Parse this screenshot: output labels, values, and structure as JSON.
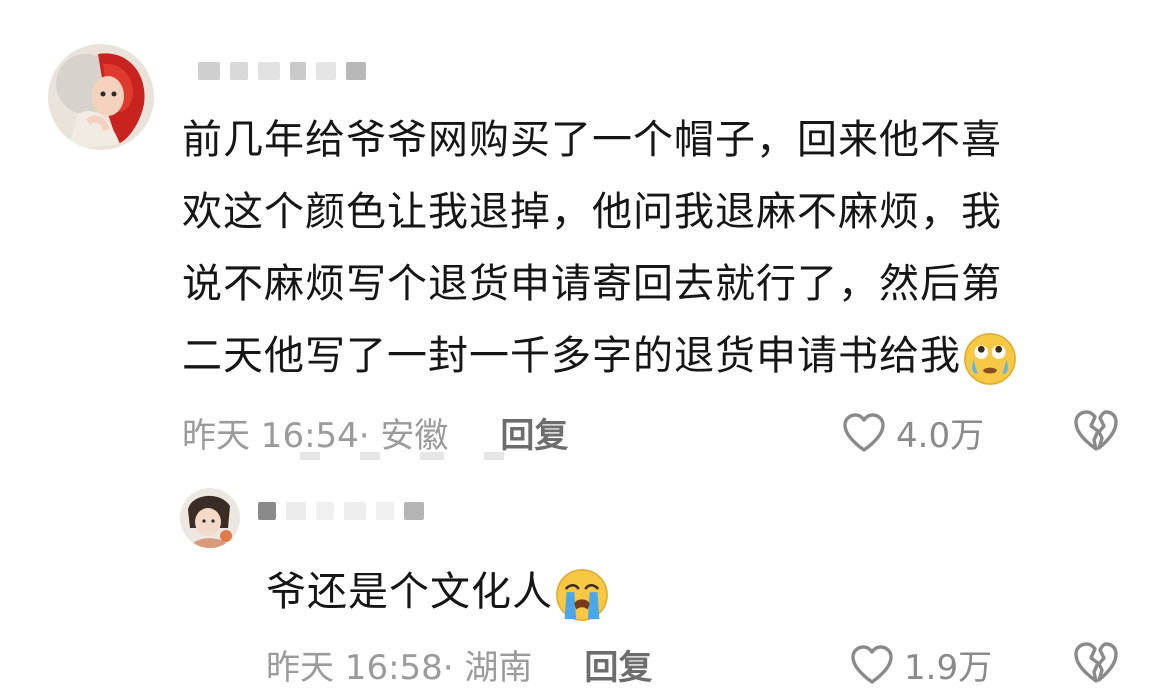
{
  "comments": [
    {
      "text_lines": [
        "前几年给爷爷网购买了一个帽子，回来他不喜",
        "欢这个颜色让我退掉，他问我退麻不麻烦，我",
        "说不麻烦写个退货申请寄回去就行了，然后第",
        "二天他写了一封一千多字的退货申请书给我"
      ],
      "emoji": "face-with-tears-looking-up",
      "time_location": "昨天 16:54· 安徽",
      "reply_label": "回复",
      "likes": "4.0万"
    },
    {
      "text_lines": [
        "爷还是个文化人"
      ],
      "emoji": "loudly-crying-face",
      "time_location": "昨天 16:58· 湖南",
      "reply_label": "回复",
      "likes": "1.9万"
    }
  ],
  "colors": {
    "text": "#161616",
    "meta": "#9b9b9b",
    "reply": "#6d6d6d",
    "icon": "#8a8a8a"
  }
}
